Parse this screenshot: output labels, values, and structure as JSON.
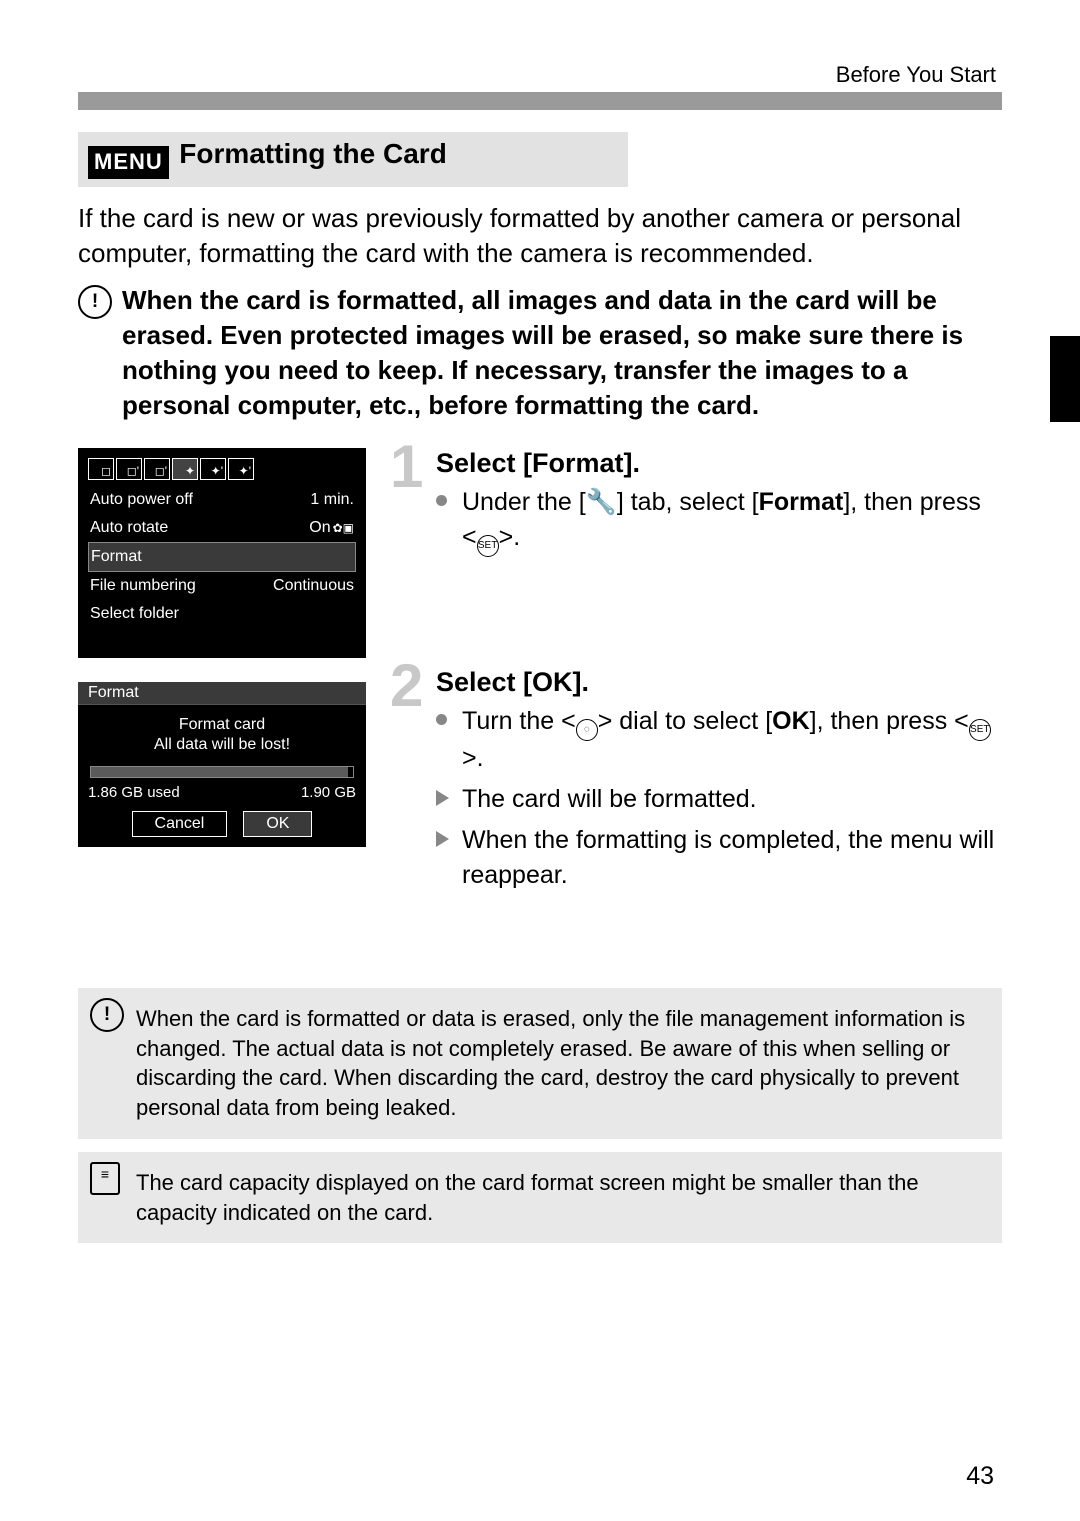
{
  "header": {
    "label": "Before You Start"
  },
  "section": {
    "menu_label": "MENU",
    "title": "Formatting the Card",
    "intro": "If the card is new or was previously formatted by another camera or personal computer, formatting the card with the camera is recommended.",
    "warning": "When the card is formatted, all images and data in the card will be erased. Even protected images will be erased, so make sure there is nothing you need to keep. If necessary, transfer the images to a personal computer, etc., before formatting the card."
  },
  "screen1": {
    "rows": {
      "auto_power_off": {
        "label": "Auto power off",
        "value": "1 min."
      },
      "auto_rotate": {
        "label": "Auto rotate",
        "value": "On"
      },
      "format": {
        "label": "Format",
        "value": ""
      },
      "file_numbering": {
        "label": "File numbering",
        "value": "Continuous"
      },
      "select_folder": {
        "label": "Select folder",
        "value": ""
      }
    }
  },
  "screen2": {
    "title": "Format",
    "line1": "Format card",
    "line2": "All data will be lost!",
    "used": "1.86 GB used",
    "total": "1.90 GB",
    "cancel": "Cancel",
    "ok": "OK"
  },
  "steps": {
    "s1": {
      "num": "1",
      "title": "Select [Format].",
      "b1a": "Under the [",
      "b1b": "] tab, select [",
      "b1_format": "Format",
      "b1c": "], then press <",
      "b1_set": "SET",
      "b1d": ">."
    },
    "s2": {
      "num": "2",
      "title": "Select [OK].",
      "b1a": "Turn the <",
      "b1b": "> dial to select [",
      "b1_ok": "OK",
      "b1c": "], then press <",
      "b1_set": "SET",
      "b1d": ">.",
      "b2": "The card will be formatted.",
      "b3": "When the formatting is completed, the menu will reappear."
    }
  },
  "notes": {
    "n1": "When the card is formatted or data is erased, only the file management information is changed. The actual data is not completely erased. Be aware of this when selling or discarding the card. When discarding the card, destroy the card physically to prevent personal data from being leaked.",
    "n2": "The card capacity displayed on the card format screen might be smaller than the capacity indicated on the card."
  },
  "page_number": "43"
}
